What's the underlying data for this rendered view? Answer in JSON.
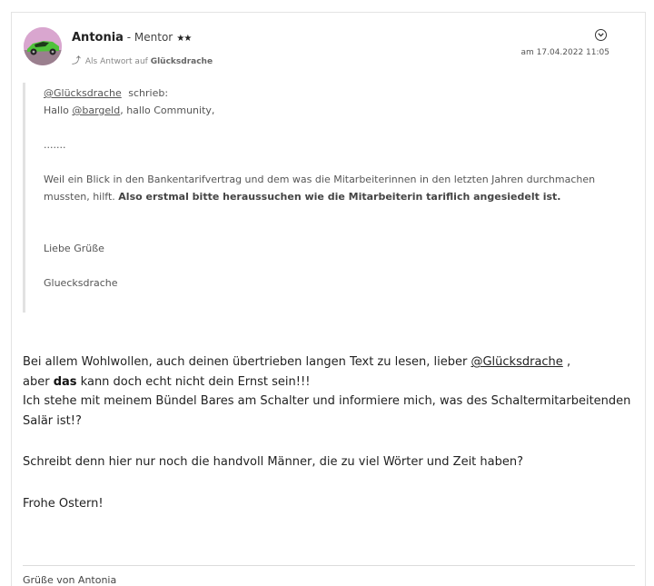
{
  "author": {
    "name": "Antonia",
    "separator": " - ",
    "rank": "Mentor",
    "stars": "★★"
  },
  "reply": {
    "prefix": "Als Antwort auf",
    "target": "Glücksdrache"
  },
  "post_date": "am 17.04.2022 11:05",
  "icons": {
    "options": "chevron-down-circle-icon",
    "reply": "reply-arrow-icon"
  },
  "quote": {
    "mention": "@Glücksdrache",
    "wrote": "schrieb:",
    "greeting_prefix": "Hallo",
    "greeting_mention": "@bargeld",
    "greeting_suffix": ", hallo Community,",
    "ellipsis": ".......",
    "para_text": "Weil ein Blick in den Bankentarifvertrag und dem was die Mitarbeiterinnen in den letzten Jahren durchmachen mussten, hilft.",
    "para_bold": "Also erstmal bitte heraussuchen wie die Mitarbeiterin tariflich angesiedelt ist.",
    "closing": "Liebe Grüße",
    "signoff": "Gluecksdrache"
  },
  "body": {
    "line1_prefix": "Bei allem Wohlwollen, auch deinen übertrieben langen Text zu lesen, lieber",
    "line1_mention": "@Glücksdrache",
    "line1_suffix": ",",
    "line2_prefix": "aber",
    "line2_bold": "das",
    "line2_suffix": "kann doch echt nicht dein Ernst sein!!!",
    "line3": "Ich stehe mit meinem Bündel Bares am Schalter und informiere mich, was des Schaltermitarbeitenden Salär ist!?",
    "para2": "Schreibt denn hier nur noch die handvoll Männer, die zu viel Wörter und Zeit haben?",
    "para3": "Frohe Ostern!"
  },
  "signature": "Grüße von Antonia",
  "colors": {
    "avatar_bg": "#d9a6cf",
    "car": "#4fc23a",
    "quote_bar": "#e2e2e2",
    "divider": "#dcdcdc"
  }
}
